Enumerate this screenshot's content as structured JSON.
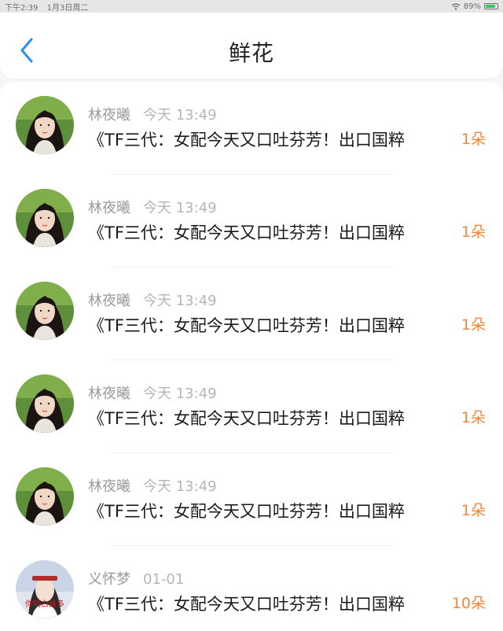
{
  "status_bar": {
    "time": "下午2:39",
    "date": "1月3日周二",
    "battery": "89%",
    "battery_level": 0.89
  },
  "header": {
    "title": "鲜花"
  },
  "colors": {
    "accent": "#2a8ff0",
    "count": "#f0873a"
  },
  "items": [
    {
      "name": "林夜曦",
      "time": "今天 13:49",
      "text": "《TF三代：女配今天又口吐芬芳！出口国粹",
      "count": "1朵"
    },
    {
      "name": "林夜曦",
      "time": "今天 13:49",
      "text": "《TF三代：女配今天又口吐芬芳！出口国粹",
      "count": "1朵"
    },
    {
      "name": "林夜曦",
      "time": "今天 13:49",
      "text": "《TF三代：女配今天又口吐芬芳！出口国粹",
      "count": "1朵"
    },
    {
      "name": "林夜曦",
      "time": "今天 13:49",
      "text": "《TF三代：女配今天又口吐芬芳！出口国粹",
      "count": "1朵"
    },
    {
      "name": "林夜曦",
      "time": "今天 13:49",
      "text": "《TF三代：女配今天又口吐芬芳！出口国粹",
      "count": "1朵"
    },
    {
      "name": "义怀梦",
      "time": "01-01",
      "text": "《TF三代：女配今天又口吐芬芳！出口国粹",
      "count": "10朵",
      "avatar_caption": "你明白最多"
    }
  ]
}
